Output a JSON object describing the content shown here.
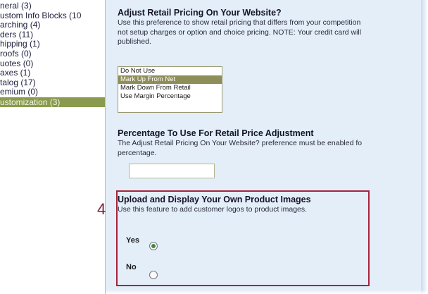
{
  "sidebar": {
    "items": [
      {
        "label": "neral (3)"
      },
      {
        "label": "ustom Info Blocks (10"
      },
      {
        "label": "arching (4)"
      },
      {
        "label": "ders (11)"
      },
      {
        "label": "hipping (1)"
      },
      {
        "label": "roofs (0)"
      },
      {
        "label": "uotes (0)"
      },
      {
        "label": "axes (1)"
      },
      {
        "label": "talog (17)"
      },
      {
        "label": "emium (0)"
      },
      {
        "label": "ustomization (3)",
        "active": true
      }
    ]
  },
  "retail_pricing": {
    "heading": "Adjust Retail Pricing On Your Website?",
    "desc_line1": "Use this preference to show retail pricing that differs from your competition",
    "desc_line2": "not setup charges or option and choice pricing. NOTE: Your credit card will",
    "desc_line3": "published.",
    "options": [
      "Do Not Use",
      "Mark Up From Net",
      "Mark Down From Retail",
      "Use Margin Percentage"
    ],
    "selected_index": 1
  },
  "percentage": {
    "heading": "Percentage To Use For Retail Price Adjustment",
    "desc_line1": "The Adjust Retail Pricing On Your Website? preference must be enabled fo",
    "desc_line2": "percentage.",
    "value": ""
  },
  "step": {
    "number": "4"
  },
  "upload_images": {
    "heading": "Upload and Display Your Own Product Images",
    "desc": "Use this feature to add customer logos to product images.",
    "yes_label": "Yes",
    "no_label": "No",
    "selected": "Yes"
  },
  "colors": {
    "active_sidebar": "#8a9a4e",
    "content_bg": "#e3eef9",
    "highlight_border": "#a8233d",
    "listbox_selected": "#8e8e58"
  }
}
